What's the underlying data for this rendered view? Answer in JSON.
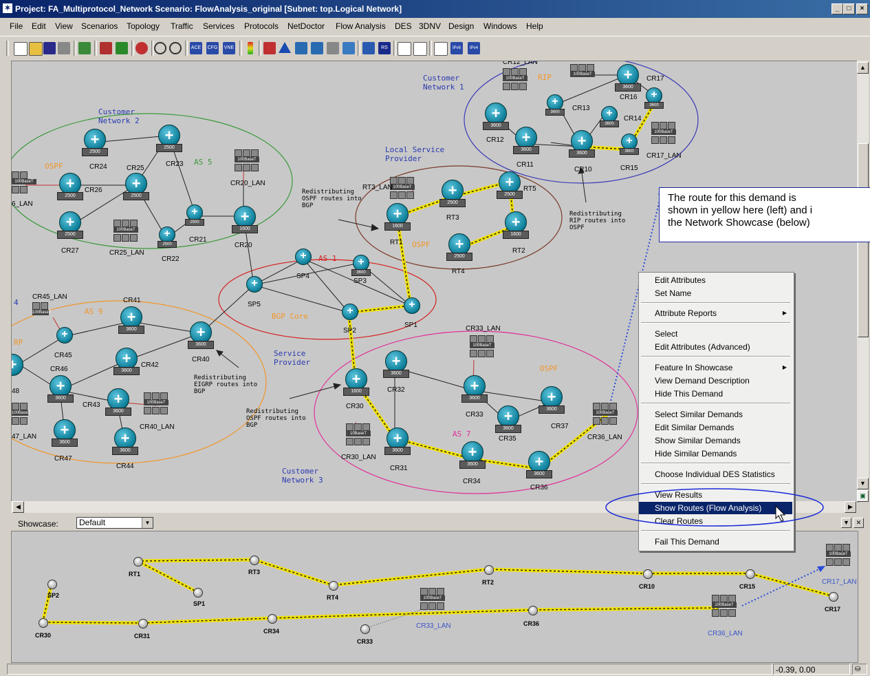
{
  "window": {
    "title": "Project: FA_Multiprotocol_Network Scenario: FlowAnalysis_original  [Subnet: top.Logical Network]",
    "buttons": [
      "_",
      "□",
      "×"
    ]
  },
  "menu": [
    "File",
    "Edit",
    "View",
    "Scenarios",
    "Topology",
    "Traffic",
    "Services",
    "Protocols",
    "NetDoctor",
    "Flow Analysis",
    "DES",
    "3DNV",
    "Design",
    "Windows",
    "Help"
  ],
  "toolbar": {
    "buttons": [
      "new-icon",
      "open-icon",
      "save-icon",
      "print-icon",
      "nodes-icon",
      "link-icon",
      "sync-icon",
      "marker-icon",
      "zoom-in-icon",
      "zoom-out-icon",
      "ace-icon",
      "cfg-icon",
      "vne-icon",
      "traffic-light-icon",
      "configure-icon",
      "triangle-icon",
      "grid-icon",
      "grid2-icon",
      "path-icon",
      "mesh-icon",
      "chart-icon",
      "rsvp-icon",
      "report-icon",
      "graph-icon",
      "doc-icon",
      "ipv6-icon",
      "ipv4-icon"
    ],
    "tags": {
      "ace": "ACE",
      "cfg": "CFG",
      "vne": "VNE",
      "rs": "RS",
      "ipv6": "IPv6",
      "ipv4": "IPv4"
    }
  },
  "groups": {
    "cn1": "Customer\nNetwork 1",
    "cn2": "Customer\nNetwork 2",
    "cn3": "Customer\nNetwork 3",
    "lsp": "Local Service\nProvider",
    "sp": "Service\nProvider",
    "rip": "RIP",
    "ospf_cn2": "OSPF",
    "as5": "AS 5",
    "ospf_lsp": "OSPF",
    "as1": "AS 1",
    "bgp_core": "BGP Core",
    "as9": "AS 9",
    "rp": "RP",
    "ospf_cn3": "OSPF",
    "as7": "AS 7",
    "col4": "4"
  },
  "annotations": {
    "a1": "Redistributing\nOSPF routes into\nBGP",
    "a2": "Redistributing\nRIP routes into\nOSPF",
    "a3": "Redistributing\nEIGRP routes into\nBGP",
    "a4": "Redistributing\nOSPF routes into\nBGP"
  },
  "nodes": {
    "CR12_LAN": "CR12_LAN",
    "CR13": "CR13",
    "CR16": "CR16",
    "CR17": "CR17",
    "CR14": "CR14",
    "CR12": "CR12",
    "CR11": "CR11",
    "CR10": "CR10",
    "CR15": "CR15",
    "CR17_LAN": "CR17_LAN",
    "CR24": "CR24",
    "CR25": "CR25",
    "CR23": "CR23",
    "CR26": "CR26",
    "LAN6": "6_LAN",
    "CR20_LAN": "CR20_LAN",
    "CR21": "CR21",
    "CR27": "CR27",
    "CR25_LAN": "CR25_LAN",
    "CR22": "CR22",
    "CR20": "CR20",
    "RT3_LAN": "RT3_LAN",
    "RT5": "RT5",
    "RT3": "RT3",
    "RT1": "RT1",
    "RT4": "RT4",
    "RT2": "RT2",
    "SP4": "SP4",
    "SP3": "SP3",
    "SP5": "SP5",
    "SP2": "SP2",
    "SP1": "SP1",
    "CR45_LAN": "CR45_LAN",
    "CR41": "CR41",
    "CR45": "CR45",
    "CR40": "CR40",
    "CR46": "CR46",
    "CR42": "CR42",
    "CR43": "CR43",
    "CR40_LAN": "CR40_LAN",
    "LAN47": "47_LAN",
    "CR47": "CR47",
    "CR44": "CR44",
    "N48": "48",
    "CR33_LAN": "CR33_LAN",
    "CR32": "CR32",
    "CR33": "CR33",
    "CR30": "CR30",
    "CR35": "CR35",
    "CR37": "CR37",
    "CR36_LAN": "CR36_LAN",
    "CR30_LAN": "CR30_LAN",
    "CR31": "CR31",
    "CR34": "CR34",
    "CR36": "CR36"
  },
  "device_tags": {
    "r2500": "2500",
    "r3600": "3600",
    "r1600": "1600",
    "hub": "100BaseT",
    "hub10": "10BaseT"
  },
  "callout": {
    "line1": "The route for this demand is",
    "line2": "shown in yellow here (left) and i",
    "line3": "the Network Showcase (below)"
  },
  "context_menu": {
    "items": [
      "Edit Attributes",
      "Set Name",
      "Attribute Reports",
      "Select",
      "Edit Attributes (Advanced)",
      "Feature In Showcase",
      "View Demand Description",
      "Hide This Demand",
      "Select Similar Demands",
      "Edit Similar Demands",
      "Show Similar Demands",
      "Hide Similar Demands",
      "Choose Individual DES Statistics",
      "View Results",
      "Show Routes (Flow Analysis)",
      "Clear Routes",
      "Fail This Demand"
    ],
    "selected": "Show Routes (Flow Analysis)"
  },
  "showcase": {
    "label": "Showcase:",
    "value": "Default",
    "nodes": [
      "RT1",
      "RT3",
      "SP2",
      "SP1",
      "RT4",
      "RT2",
      "CR10",
      "CR15",
      "CR17",
      "CR30",
      "CR31",
      "CR34",
      "CR33",
      "CR36"
    ],
    "lans": [
      "CR33_LAN",
      "CR36_LAN",
      "CR17_LAN"
    ],
    "hub_tag": "100BaseT"
  },
  "status": {
    "coords": "-0.39, 0.00"
  },
  "colors": {
    "route": "#f2e200",
    "cn1": "#3a3ab8",
    "cn2": "#3a9a3a",
    "lsp": "#7a3a28",
    "bgp": "#d42020",
    "cn3": "#e0309a",
    "as9": "#f0962a",
    "callout_border": "#1a2a9c"
  }
}
